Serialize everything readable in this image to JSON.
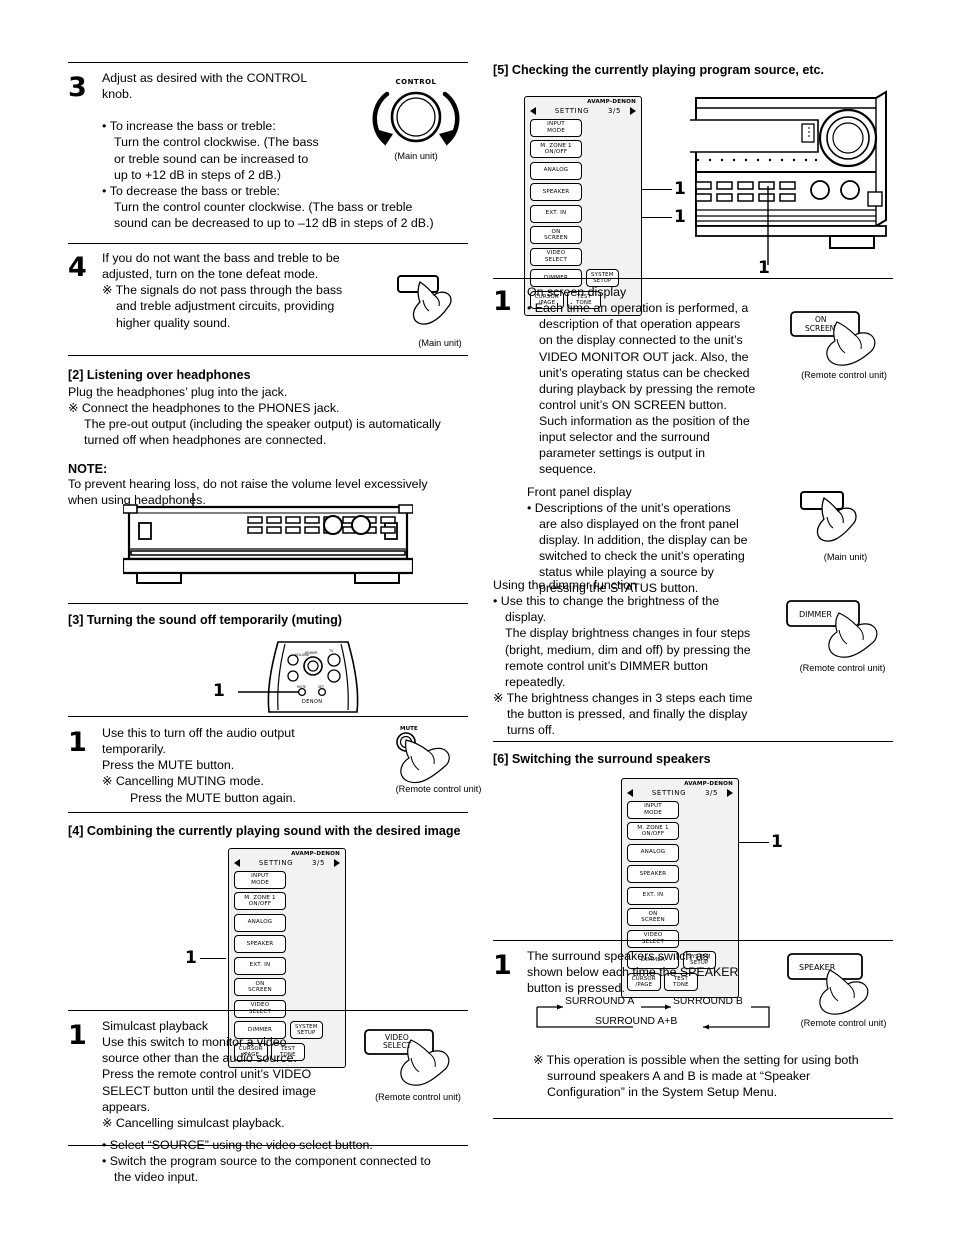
{
  "document": {
    "type": "instruction-manual-page",
    "brand": "DENON"
  },
  "left_column": {
    "step3": {
      "number": "3",
      "lead": "Adjust as desired with the CONTROL knob.",
      "bullets": [
        "To increase the bass or treble: Turn the control clockwise. (The bass or treble sound can be increased to up to +12 dB in steps of 2 dB.)",
        "To decrease the bass or treble: Turn the control counter clockwise. (The bass or treble sound can be decreased to up to –12 dB in steps of 2 dB.)"
      ],
      "bullet1_lines": [
        "To increase the bass or treble:",
        "Turn the control clockwise. (The bass",
        "or treble sound can be increased to",
        "up to +12 dB in steps of 2 dB.)"
      ],
      "bullet2_lines": [
        "To decrease the bass or treble:",
        "Turn  the  control  counter  clockwise.  (The  bass  or  treble",
        "sound can be decreased to up to –12 dB in steps of 2 dB.)"
      ],
      "figure": {
        "knob_label": "CONTROL",
        "caption": "(Main unit)"
      }
    },
    "step4": {
      "number": "4",
      "lines": [
        "If you do not want the bass and treble to be",
        "adjusted, turn on the tone defeat mode."
      ],
      "note_marker": "※",
      "note_lines": [
        "The signals do not pass through the bass",
        "and treble adjustment circuits, providing",
        "higher quality sound."
      ],
      "figure": {
        "caption": "(Main unit)"
      }
    },
    "section2": {
      "heading": "[2]  Listening over headphones",
      "line1": "Plug the headphones’ plug into the jack.",
      "note_marker": "※",
      "note_lines": [
        "Connect the headphones to the PHONES jack.",
        "The pre-out output (including the speaker output) is automatically",
        "turned off when headphones are connected."
      ],
      "note_heading": "NOTE:",
      "note_body_lines": [
        "To  prevent  hearing  loss,  do  not  raise  the  volume  level  excessively",
        "when using headphones."
      ]
    },
    "section3": {
      "heading": "[3]  Turning the sound off temporarily (muting)",
      "figure": {
        "brand": "DENON",
        "callout": "1"
      },
      "step1": {
        "number": "1",
        "lines": [
          "Use  this  to  turn  off  the  audio  output",
          "temporarily.",
          "Press the MUTE button."
        ],
        "note_marker": "※",
        "note_lines": [
          "Cancelling MUTING mode.",
          "Press the MUTE button again."
        ],
        "figure": {
          "button_label": "MUTE",
          "caption": "(Remote control unit)"
        }
      }
    },
    "section4": {
      "heading": "[4]  Combining the currently playing sound with the desired image",
      "remote": {
        "brand": "AVAMP-DENON",
        "title": "SETTING",
        "page": "3/5",
        "left_arrow": "left-triangle-icon",
        "right_arrow": "right-triangle-icon",
        "keys": [
          "INPUT\nMODE",
          "M. ZONE 1\nON/OFF",
          "ANALOG",
          "SPEAKER",
          "EXT. IN",
          "ON\nSCREEN",
          "VIDEO\nSELECT",
          "DIMMER"
        ],
        "bottom_keys": [
          "SYSTEM\nSETUP",
          "CURSOR\n/PAGE",
          "TEST\nTONE"
        ],
        "callout": "1"
      },
      "step1": {
        "number": "1",
        "title": "Simulcast playback",
        "lines": [
          "Use  this  switch  to  monitor  a  video",
          "source other than the audio source.",
          "Press  the  remote  control  unit’s  VIDEO",
          "SELECT button until the desired image",
          "appears."
        ],
        "note_marker": "※",
        "note_line": "Cancelling simulcast playback.",
        "bullets": [
          "Select “SOURCE” using the video select button.",
          "Switch the program source to the component connected to the video input."
        ],
        "bullet2_lines": [
          "Switch the program source to the component connected to",
          "the video input."
        ],
        "figure": {
          "button_label": "VIDEO\nSELECT",
          "caption": "(Remote control unit)"
        }
      }
    }
  },
  "right_column": {
    "section5": {
      "heading": "[5]  Checking the currently playing program source, etc.",
      "remote": {
        "brand": "AVAMP-DENON",
        "title": "SETTING",
        "page": "3/5",
        "keys": [
          "INPUT\nMODE",
          "M. ZONE 1\nON/OFF",
          "ANALOG",
          "SPEAKER",
          "EXT. IN",
          "ON\nSCREEN",
          "VIDEO\nSELECT",
          "DIMMER"
        ],
        "bottom_keys": [
          "SYSTEM\nSETUP",
          "CURSOR\n/PAGE",
          "TEST\nTONE"
        ],
        "callout_onscreen": "1",
        "callout_dimmer": "1"
      },
      "unit_callout": "1",
      "step1": {
        "number": "1",
        "sub1_title": "On screen display",
        "sub1_lines": [
          "Each time an operation is performed, a",
          "description  of  that  operation  appears",
          "on the display connected to the unit’s",
          "VIDEO MONITOR OUT jack. Also, the",
          "unit’s operating status can be checked",
          "during playback by pressing the remote",
          "control unit’s ON SCREEN button.",
          "Such information as the position of the",
          "input  selector  and  the  surround",
          "parameter  settings  is  output  in",
          "sequence."
        ],
        "sub2_title": "Front panel display",
        "sub2_lines": [
          "Descriptions  of  the  unit’s  operations",
          "are also displayed on the front panel",
          "display. In addition, the display can be",
          "switched to check the unit’s operating",
          "status  while  playing  a  source  by",
          "pressing the STATUS button."
        ],
        "figure_onscreen": {
          "button_label": "ON\nSCREEN",
          "caption": "(Remote control unit)"
        },
        "figure_status": {
          "caption": "(Main unit)"
        }
      },
      "dimmer": {
        "title": "Using the dimmer function",
        "lines": [
          "Use  this  to  change  the  brightness  of  the",
          "display.",
          "The display brightness changes in four steps",
          "(bright, medium, dim and off) by pressing the",
          "remote  control  unit’s  DIMMER  button",
          "repeatedly."
        ],
        "note_marker": "※",
        "note_lines": [
          "The brightness changes in 3 steps each time",
          "the button is pressed, and finally the display",
          "turns off."
        ],
        "figure": {
          "button_label": "DIMMER",
          "caption": "(Remote control unit)"
        }
      }
    },
    "section6": {
      "heading": "[6]  Switching the surround speakers",
      "remote": {
        "brand": "AVAMP-DENON",
        "title": "SETTING",
        "page": "3/5",
        "keys": [
          "INPUT\nMODE",
          "M. ZONE 1\nON/OFF",
          "ANALOG",
          "SPEAKER",
          "EXT. IN",
          "ON\nSCREEN",
          "VIDEO\nSELECT",
          "DIMMER"
        ],
        "bottom_keys": [
          "SYSTEM\nSETUP",
          "CURSOR\n/PAGE",
          "TEST\nTONE"
        ],
        "callout_speaker": "1"
      },
      "step1": {
        "number": "1",
        "lines": [
          "The  surround  speakers  switch  as",
          "shown below each time the SPEAKER",
          "button is pressed."
        ],
        "flow": {
          "items": [
            "SURROUND A",
            "SURROUND B",
            "SURROUND A+B"
          ]
        },
        "note_marker": "※",
        "note_lines": [
          "This operation is possible when the setting for using both",
          "surround  speakers  A  and  B  is  made  at  “Speaker",
          "Configuration” in the System Setup Menu."
        ],
        "figure": {
          "button_label": "SPEAKER",
          "caption": "(Remote control unit)"
        }
      }
    }
  }
}
